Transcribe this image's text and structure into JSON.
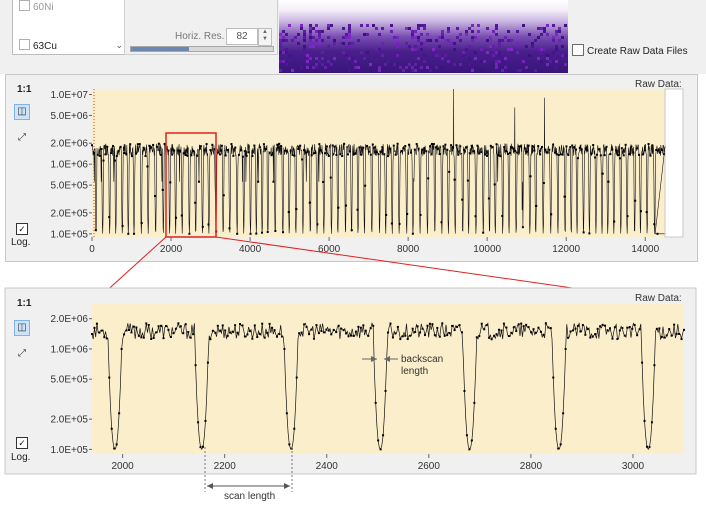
{
  "isotopes": {
    "items": [
      "60Ni",
      "63Cu"
    ]
  },
  "resolution": {
    "label": "Horiz. Res.",
    "value": "82"
  },
  "raw_data_files": {
    "label": "Create Raw Data Files",
    "checked": false
  },
  "overview": {
    "zoom_label": "1:1",
    "raw_data_label": "Raw Data:",
    "log_label": "Log.",
    "log_checked": true,
    "y_ticks": [
      "1.0E+07",
      "5.0E+06",
      "2.0E+06",
      "1.0E+06",
      "5.0E+05",
      "2.0E+05",
      "1.0E+05"
    ],
    "x_ticks": [
      "0",
      "2000",
      "4000",
      "6000",
      "8000",
      "10000",
      "12000",
      "14000"
    ]
  },
  "detail": {
    "zoom_label": "1:1",
    "raw_data_label": "Raw Data:",
    "log_label": "Log.",
    "log_checked": true,
    "y_ticks": [
      "2.0E+06",
      "1.0E+06",
      "5.0E+05",
      "2.0E+05",
      "1.0E+05"
    ],
    "x_ticks": [
      "2000",
      "2200",
      "2400",
      "2600",
      "2800",
      "3000"
    ]
  },
  "annotations": {
    "backscan": [
      "backscan",
      "length"
    ],
    "scan_length": "scan length"
  },
  "colors": {
    "plot_bg": "#fbeecb",
    "zoom_box": "#e02020",
    "trace": "#111111"
  },
  "chart_data": [
    {
      "type": "line",
      "title": "",
      "xlabel": "",
      "ylabel": "",
      "xlim": [
        0,
        14500
      ],
      "ylim": [
        90000,
        12000000
      ],
      "y_scale": "log",
      "series": [
        {
          "name": "",
          "baseline": 1600000,
          "dip_minimum": 100000,
          "dip_period": 170,
          "spikes": [
            {
              "x": 9150,
              "y": 12000000
            },
            {
              "x": 11450,
              "y": 9000000
            },
            {
              "x": 10700,
              "y": 6500000
            }
          ]
        }
      ]
    },
    {
      "type": "line",
      "title": "",
      "xlabel": "",
      "ylabel": "",
      "xlim": [
        1940,
        3100
      ],
      "ylim": [
        90000,
        2800000
      ],
      "y_scale": "log",
      "series": [
        {
          "name": "",
          "baseline": 1500000,
          "dip_minimum": 100000,
          "dip_centers": [
            1985,
            2155,
            2330,
            2505,
            2680,
            2855,
            3030
          ]
        }
      ]
    }
  ]
}
